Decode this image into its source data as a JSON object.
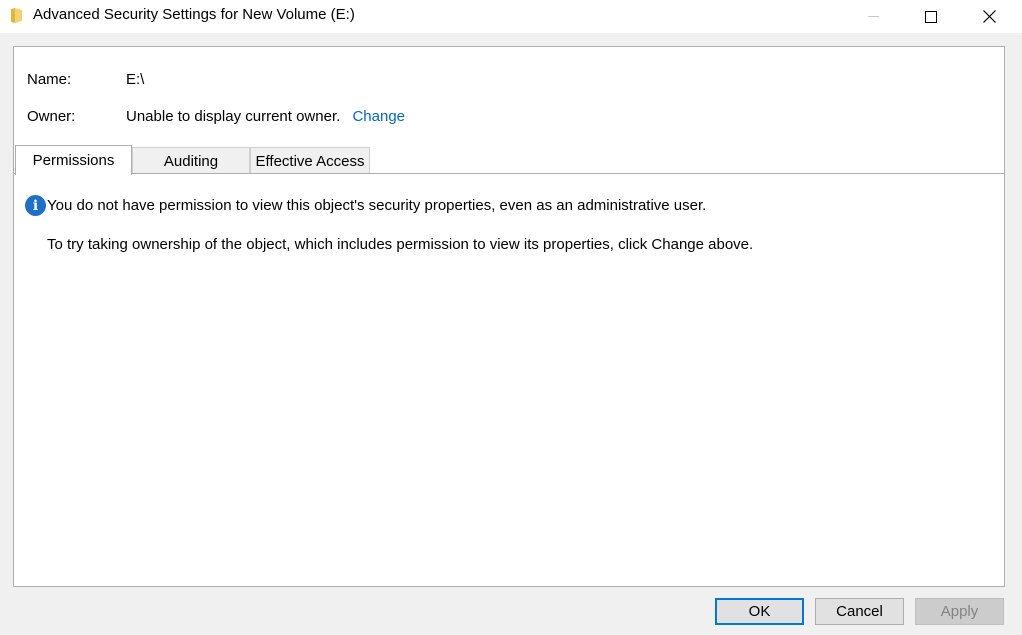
{
  "window": {
    "title": "Advanced Security Settings for New Volume (E:)",
    "icon": "folder-icon"
  },
  "details": {
    "name_label": "Name:",
    "name_value": "E:\\",
    "owner_label": "Owner:",
    "owner_value": "Unable to display current owner.",
    "owner_change_link": "Change"
  },
  "tabs": [
    {
      "label": "Permissions",
      "active": true
    },
    {
      "label": "Auditing",
      "active": false
    },
    {
      "label": "Effective Access",
      "active": false
    }
  ],
  "message": {
    "icon": "info-icon",
    "line1": "You do not have permission to view this object's security properties, even as an administrative user.",
    "line2": "To try taking ownership of the object, which includes permission to view its properties, click Change above."
  },
  "buttons": {
    "ok": "OK",
    "cancel": "Cancel",
    "apply": "Apply"
  },
  "colors": {
    "link": "#0066cc",
    "accent": "#0078d7",
    "info_icon": "#1e6fc9"
  }
}
